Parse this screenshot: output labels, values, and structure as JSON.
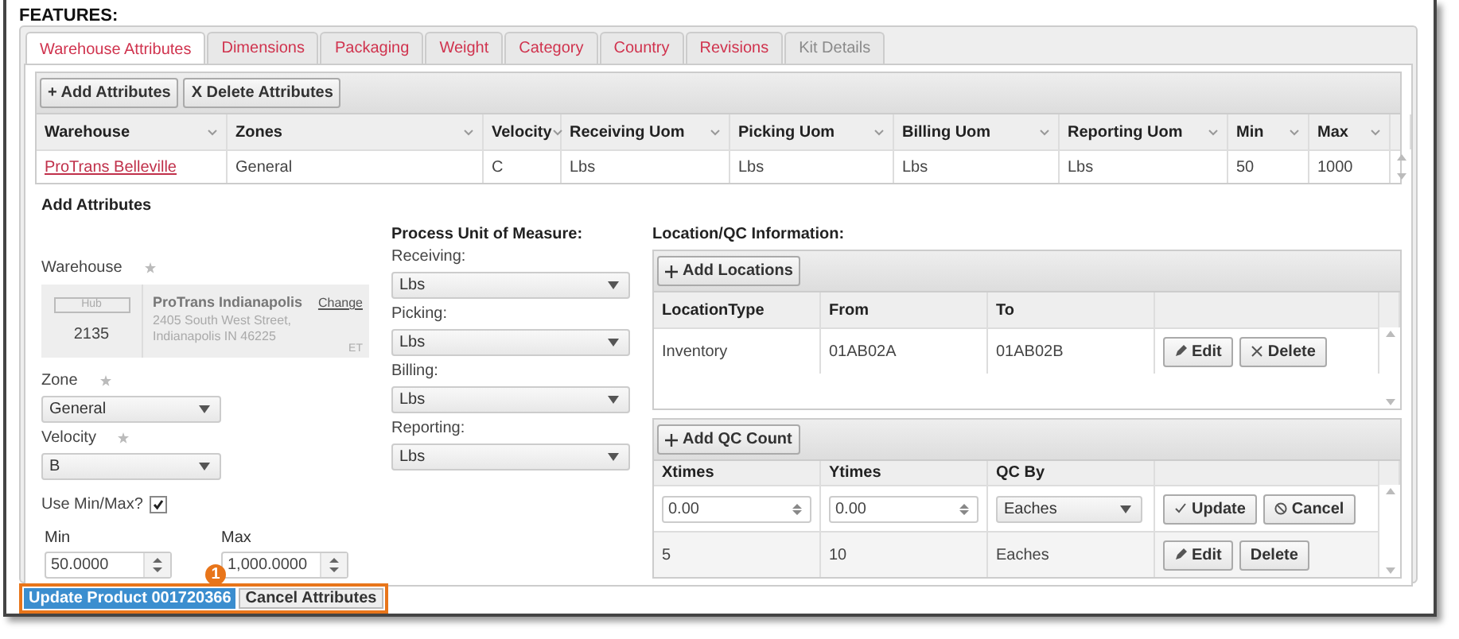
{
  "section_title": "FEATURES:",
  "tabs": [
    {
      "label": "Warehouse Attributes",
      "selected": true,
      "disabled": false
    },
    {
      "label": "Dimensions",
      "selected": false,
      "disabled": false
    },
    {
      "label": "Packaging",
      "selected": false,
      "disabled": false
    },
    {
      "label": "Weight",
      "selected": false,
      "disabled": false
    },
    {
      "label": "Category",
      "selected": false,
      "disabled": false
    },
    {
      "label": "Country",
      "selected": false,
      "disabled": false
    },
    {
      "label": "Revisions",
      "selected": false,
      "disabled": false
    },
    {
      "label": "Kit Details",
      "selected": false,
      "disabled": true
    }
  ],
  "toolbar_buttons": [
    "+ Add Attributes",
    "X Delete Attributes"
  ],
  "attributes_table": {
    "columns": [
      "Warehouse",
      "Zones",
      "Velocity",
      "Receiving Uom",
      "Picking Uom",
      "Billing Uom",
      "Reporting Uom",
      "Min",
      "Max"
    ],
    "rows": [
      {
        "cells": [
          "ProTrans Belleville",
          "General",
          "C",
          "Lbs",
          "Lbs",
          "Lbs",
          "Lbs",
          "50",
          "1000"
        ]
      }
    ]
  },
  "form": {
    "title": "Add Attributes",
    "warehouse": {
      "label": "Warehouse",
      "required": true,
      "hub_badge": "Hub",
      "code": "2135",
      "name": "ProTrans Indianapolis",
      "change_link": "Change",
      "address_lines": [
        "2405 South West Street,",
        "Indianapolis IN 46225"
      ],
      "timezone": "ET"
    },
    "zone": {
      "label": "Zone",
      "required": true,
      "value": "General"
    },
    "velocity": {
      "label": "Velocity",
      "required": true,
      "value": "B"
    },
    "use_min_max": {
      "label": "Use Min/Max?",
      "checked": true
    },
    "min": {
      "label": "Min",
      "value": "50.0000"
    },
    "max": {
      "label": "Max",
      "value": "1,000.0000"
    }
  },
  "uom": {
    "title": "Process Unit of Measure:",
    "fields": [
      {
        "label": "Receiving:",
        "value": "Lbs"
      },
      {
        "label": "Picking:",
        "value": "Lbs"
      },
      {
        "label": "Billing:",
        "value": "Lbs"
      },
      {
        "label": "Reporting:",
        "value": "Lbs"
      }
    ]
  },
  "location_qc": {
    "title": "Location/QC Information:",
    "locations": {
      "add_button": "Add Locations",
      "columns": [
        "LocationType",
        "From",
        "To"
      ],
      "rows": [
        {
          "cells": [
            "Inventory",
            "01AB02A",
            "01AB02B"
          ],
          "actions": [
            {
              "label": "Edit",
              "kind": "edit"
            },
            {
              "label": "Delete",
              "kind": "remove"
            }
          ]
        }
      ]
    },
    "qc": {
      "add_button": "Add QC Count",
      "columns": [
        "Xtimes",
        "Ytimes",
        "QC By"
      ],
      "rows": [
        {
          "kind": "edit",
          "cells": [
            "0.00",
            "0.00",
            "Eaches"
          ],
          "actions": [
            {
              "label": "Update",
              "kind": "confirm"
            },
            {
              "label": "Cancel",
              "kind": "cancel"
            }
          ]
        },
        {
          "kind": "view",
          "cells": [
            "5",
            "10",
            "Eaches"
          ],
          "actions": [
            {
              "label": "Edit",
              "kind": "edit"
            },
            {
              "label": "Delete",
              "kind": "plain"
            }
          ]
        }
      ]
    }
  },
  "footer": {
    "buttons": [
      {
        "label": "Update Product 001720366",
        "kind": "primary"
      },
      {
        "label": "Cancel Attributes",
        "kind": "default"
      }
    ],
    "callout": "1"
  }
}
